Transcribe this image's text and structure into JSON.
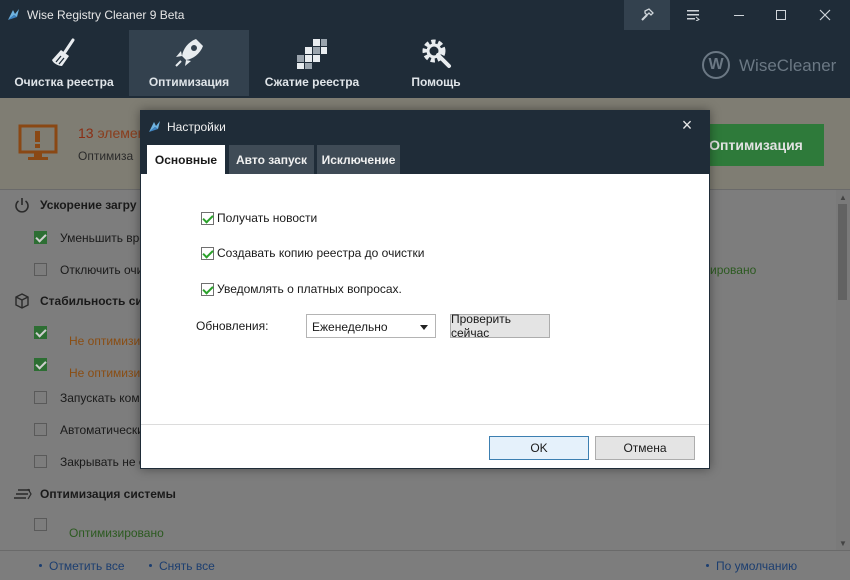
{
  "window": {
    "title": "Wise Registry Cleaner 9 Beta",
    "controls": [
      "hammer-icon",
      "menu-icon",
      "minimize-icon",
      "maximize-icon",
      "close-icon"
    ]
  },
  "toolbar": {
    "items": [
      {
        "label": "Очистка реестра",
        "icon": "broom-icon"
      },
      {
        "label": "Оптимизация",
        "icon": "rocket-icon",
        "active": true
      },
      {
        "label": "Сжатие реестра",
        "icon": "blocks-icon"
      },
      {
        "label": "Помощь",
        "icon": "gear-wrench-icon"
      }
    ],
    "brand": "WiseCleaner",
    "brand_letter": "W"
  },
  "summary": {
    "count": "13",
    "count_suffix": "элемен",
    "text": "Оптимиза",
    "button": "Оптимизация"
  },
  "sections": [
    {
      "title": "Ускорение загру",
      "icon": "power-icon"
    },
    {
      "title": "Стабильность си",
      "icon": "cube-icon"
    },
    {
      "title": "Оптимизация системы",
      "icon": "speed-icon"
    }
  ],
  "rows": {
    "r1": "Уменьшить врем",
    "r2": "Отключить очи",
    "r2_right": "ировано",
    "r3": "Не оптимизиро",
    "r4": "Не оптимизиро",
    "r5": "Запускать комп",
    "r6": "Автоматический",
    "r7": "Закрывать не о",
    "r8": "Оптимизировано"
  },
  "footer": {
    "check_all": "Отметить все",
    "uncheck_all": "Снять все",
    "default": "По умолчанию"
  },
  "dialog": {
    "title": "Настройки",
    "close": "×",
    "tabs": [
      "Основные",
      "Авто запуск",
      "Исключение"
    ],
    "options": [
      {
        "label": "Получать новости",
        "checked": true
      },
      {
        "label": "Создавать копию реестра до очистки",
        "checked": true
      },
      {
        "label": "Уведомлять о платных вопросах.",
        "checked": true
      }
    ],
    "updates_label": "Обновления:",
    "updates_value": "Еженедельно",
    "check_now": "Проверить сейчас",
    "ok": "OK",
    "cancel": "Отмена"
  },
  "colors": {
    "chrome": "#1f2c38",
    "active_tab": "#33414e",
    "accent_green": "#2e7a3a"
  }
}
